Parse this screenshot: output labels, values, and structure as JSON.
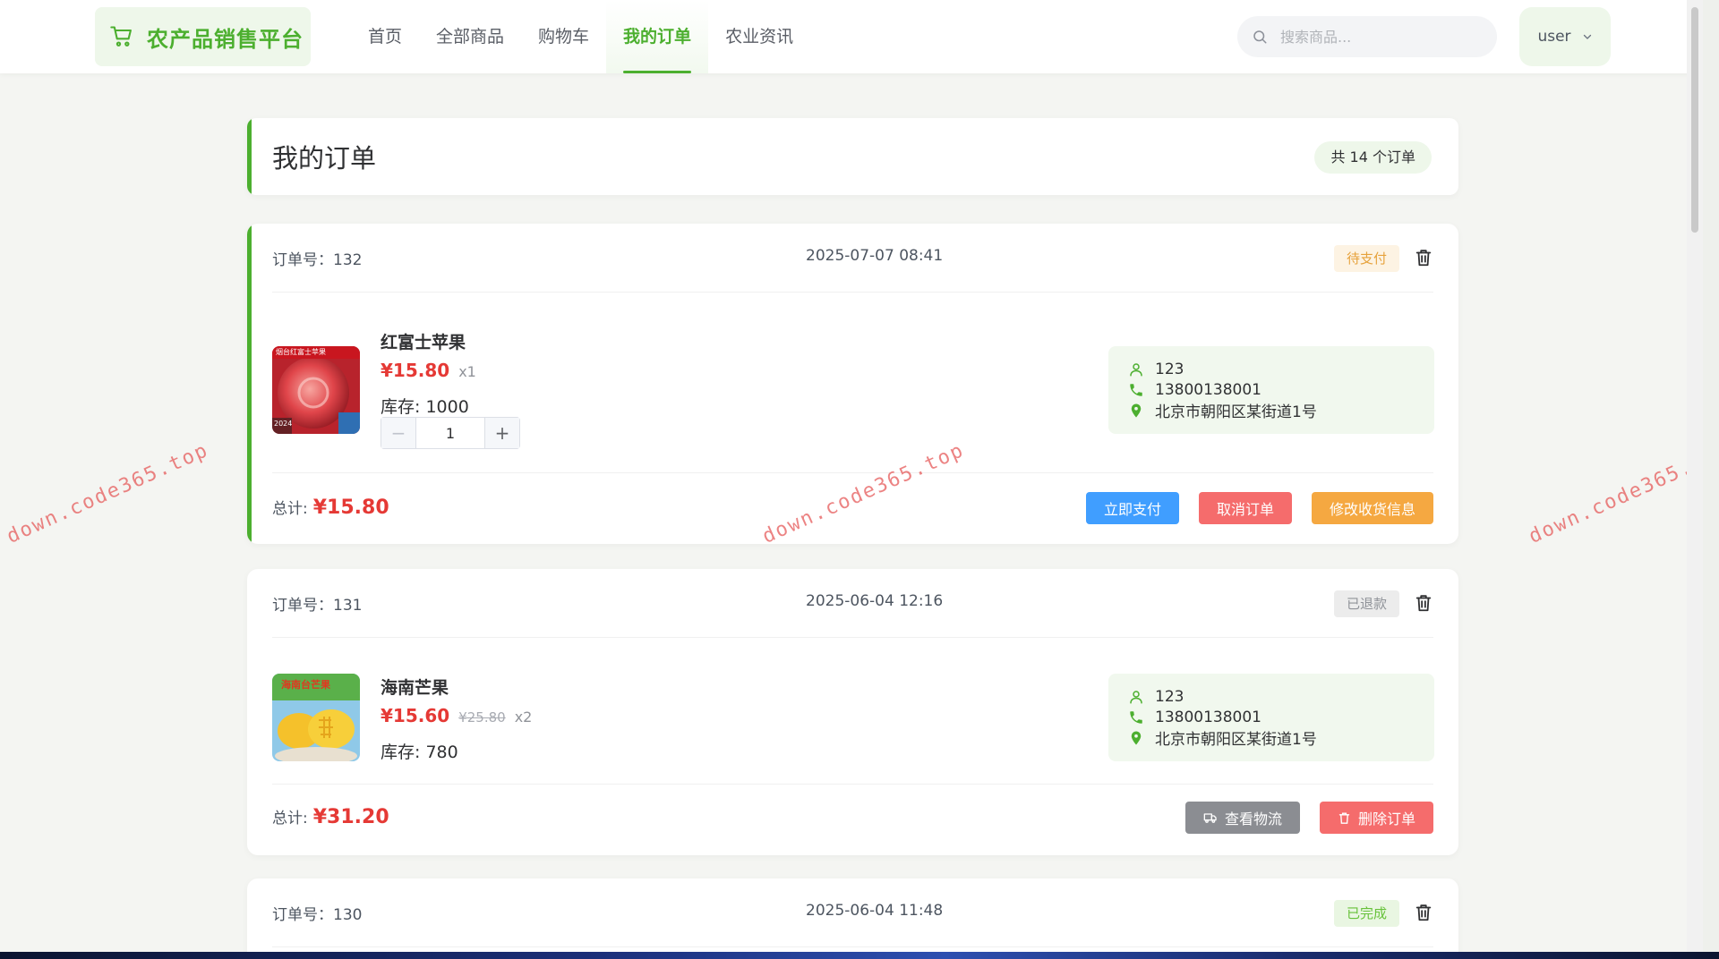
{
  "header": {
    "site_title": "农产品销售平台",
    "nav": [
      "首页",
      "全部商品",
      "购物车",
      "我的订单",
      "农业资讯"
    ],
    "active_nav": "我的订单",
    "search_placeholder": "搜索商品...",
    "user_label": "user"
  },
  "page": {
    "title": "我的订单",
    "count_text": "共 14 个订单"
  },
  "labels": {
    "stock_prefix": "库存: ",
    "total_prefix": "总计:"
  },
  "orders": [
    {
      "order_no": "订单号：132",
      "time": "2025-07-07 08:41",
      "status": "待支付",
      "product": {
        "name": "红富士苹果",
        "price": "¥15.80",
        "quantity": "x1",
        "stock": "库存: 1000",
        "stepper_value": "1",
        "image_caption": "烟台红富士苹果",
        "image_year": "2024"
      },
      "recipient": "123",
      "phone": "13800138001",
      "address": "北京市朝阳区某街道1号",
      "total": "¥15.80",
      "actions": [
        "立即支付",
        "取消订单",
        "修改收货信息"
      ]
    },
    {
      "order_no": "订单号：131",
      "time": "2025-06-04 12:16",
      "status": "已退款",
      "product": {
        "name": "海南芒果",
        "price": "¥15.60",
        "original_price": "¥25.80",
        "quantity": "x2",
        "stock": "库存: 780",
        "image_caption": "海南台芒果"
      },
      "recipient": "123",
      "phone": "13800138001",
      "address": "北京市朝阳区某街道1号",
      "total": "¥31.20",
      "actions": [
        "查看物流",
        "删除订单"
      ]
    },
    {
      "order_no": "订单号：130",
      "time": "2025-06-04 11:48",
      "status": "已完成"
    }
  ],
  "watermark_text": "down.code365.top",
  "colors": {
    "brand_green": "#4caf2f",
    "price_red": "#e53935",
    "pay_blue": "#409eff",
    "cancel_red": "#f56c6c",
    "edit_orange": "#f5a841",
    "logistics_gray": "#8b8d92"
  }
}
